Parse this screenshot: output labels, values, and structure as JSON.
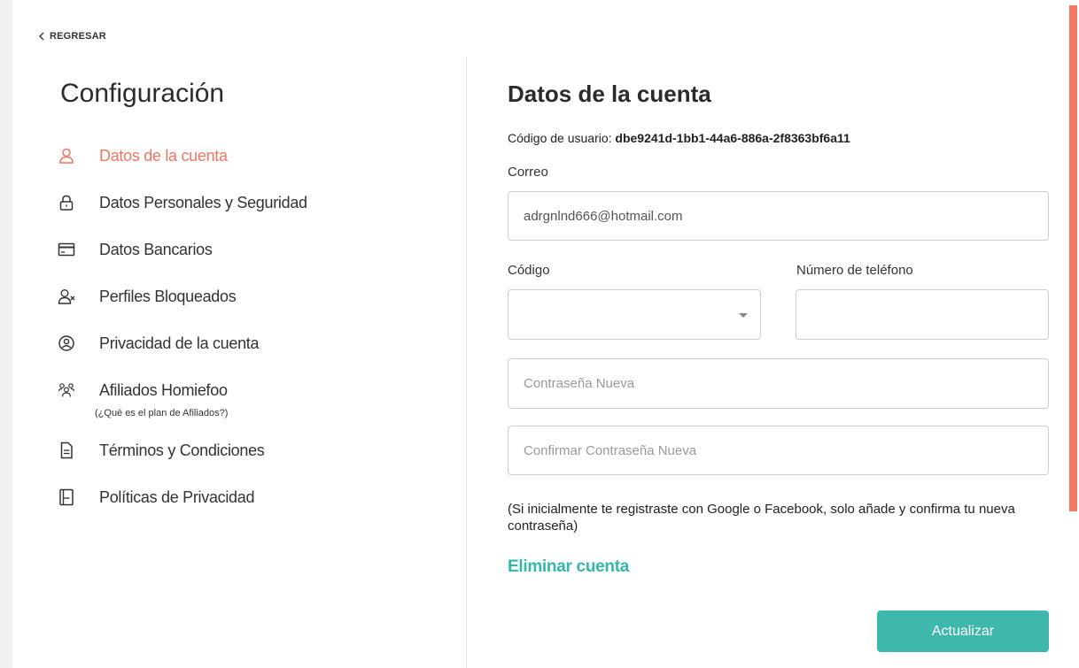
{
  "nav": {
    "back_label": "REGRESAR"
  },
  "sidebar": {
    "title": "Configuración",
    "items": [
      {
        "label": "Datos de la cuenta",
        "icon": "user-icon",
        "active": true
      },
      {
        "label": "Datos Personales y Seguridad",
        "icon": "lock-icon"
      },
      {
        "label": "Datos Bancarios",
        "icon": "credit-card-icon"
      },
      {
        "label": "Perfiles Bloqueados",
        "icon": "user-blocked-icon"
      },
      {
        "label": "Privacidad de la cuenta",
        "icon": "user-circle-icon"
      },
      {
        "label": "Afiliados Homiefoo",
        "icon": "users-group-icon",
        "sublabel": "(¿Qué es el plan de Afiliados?)"
      },
      {
        "label": "Términos y Condiciones",
        "icon": "document-icon"
      },
      {
        "label": "Políticas de Privacidad",
        "icon": "policy-icon"
      }
    ]
  },
  "main": {
    "title": "Datos de la cuenta",
    "user_code_label": "Código de usuario:",
    "user_code_value": "dbe9241d-1bb1-44a6-886a-2f8363bf6a11",
    "email_label": "Correo",
    "email_value": "adrgnlnd666@hotmail.com",
    "code_label": "Código",
    "code_value": "",
    "phone_label": "Número de teléfono",
    "phone_value": "",
    "new_password_placeholder": "Contraseña Nueva",
    "confirm_password_placeholder": "Confirmar Contraseña Nueva",
    "note": "(Si inicialmente te registraste con Google o Facebook, solo añade y confirma tu nueva contraseña)",
    "delete_label": "Eliminar cuenta",
    "update_label": "Actualizar"
  },
  "colors": {
    "accent": "#f07762",
    "teal": "#3fb8ac",
    "scroll_accent": "#f47a62"
  }
}
